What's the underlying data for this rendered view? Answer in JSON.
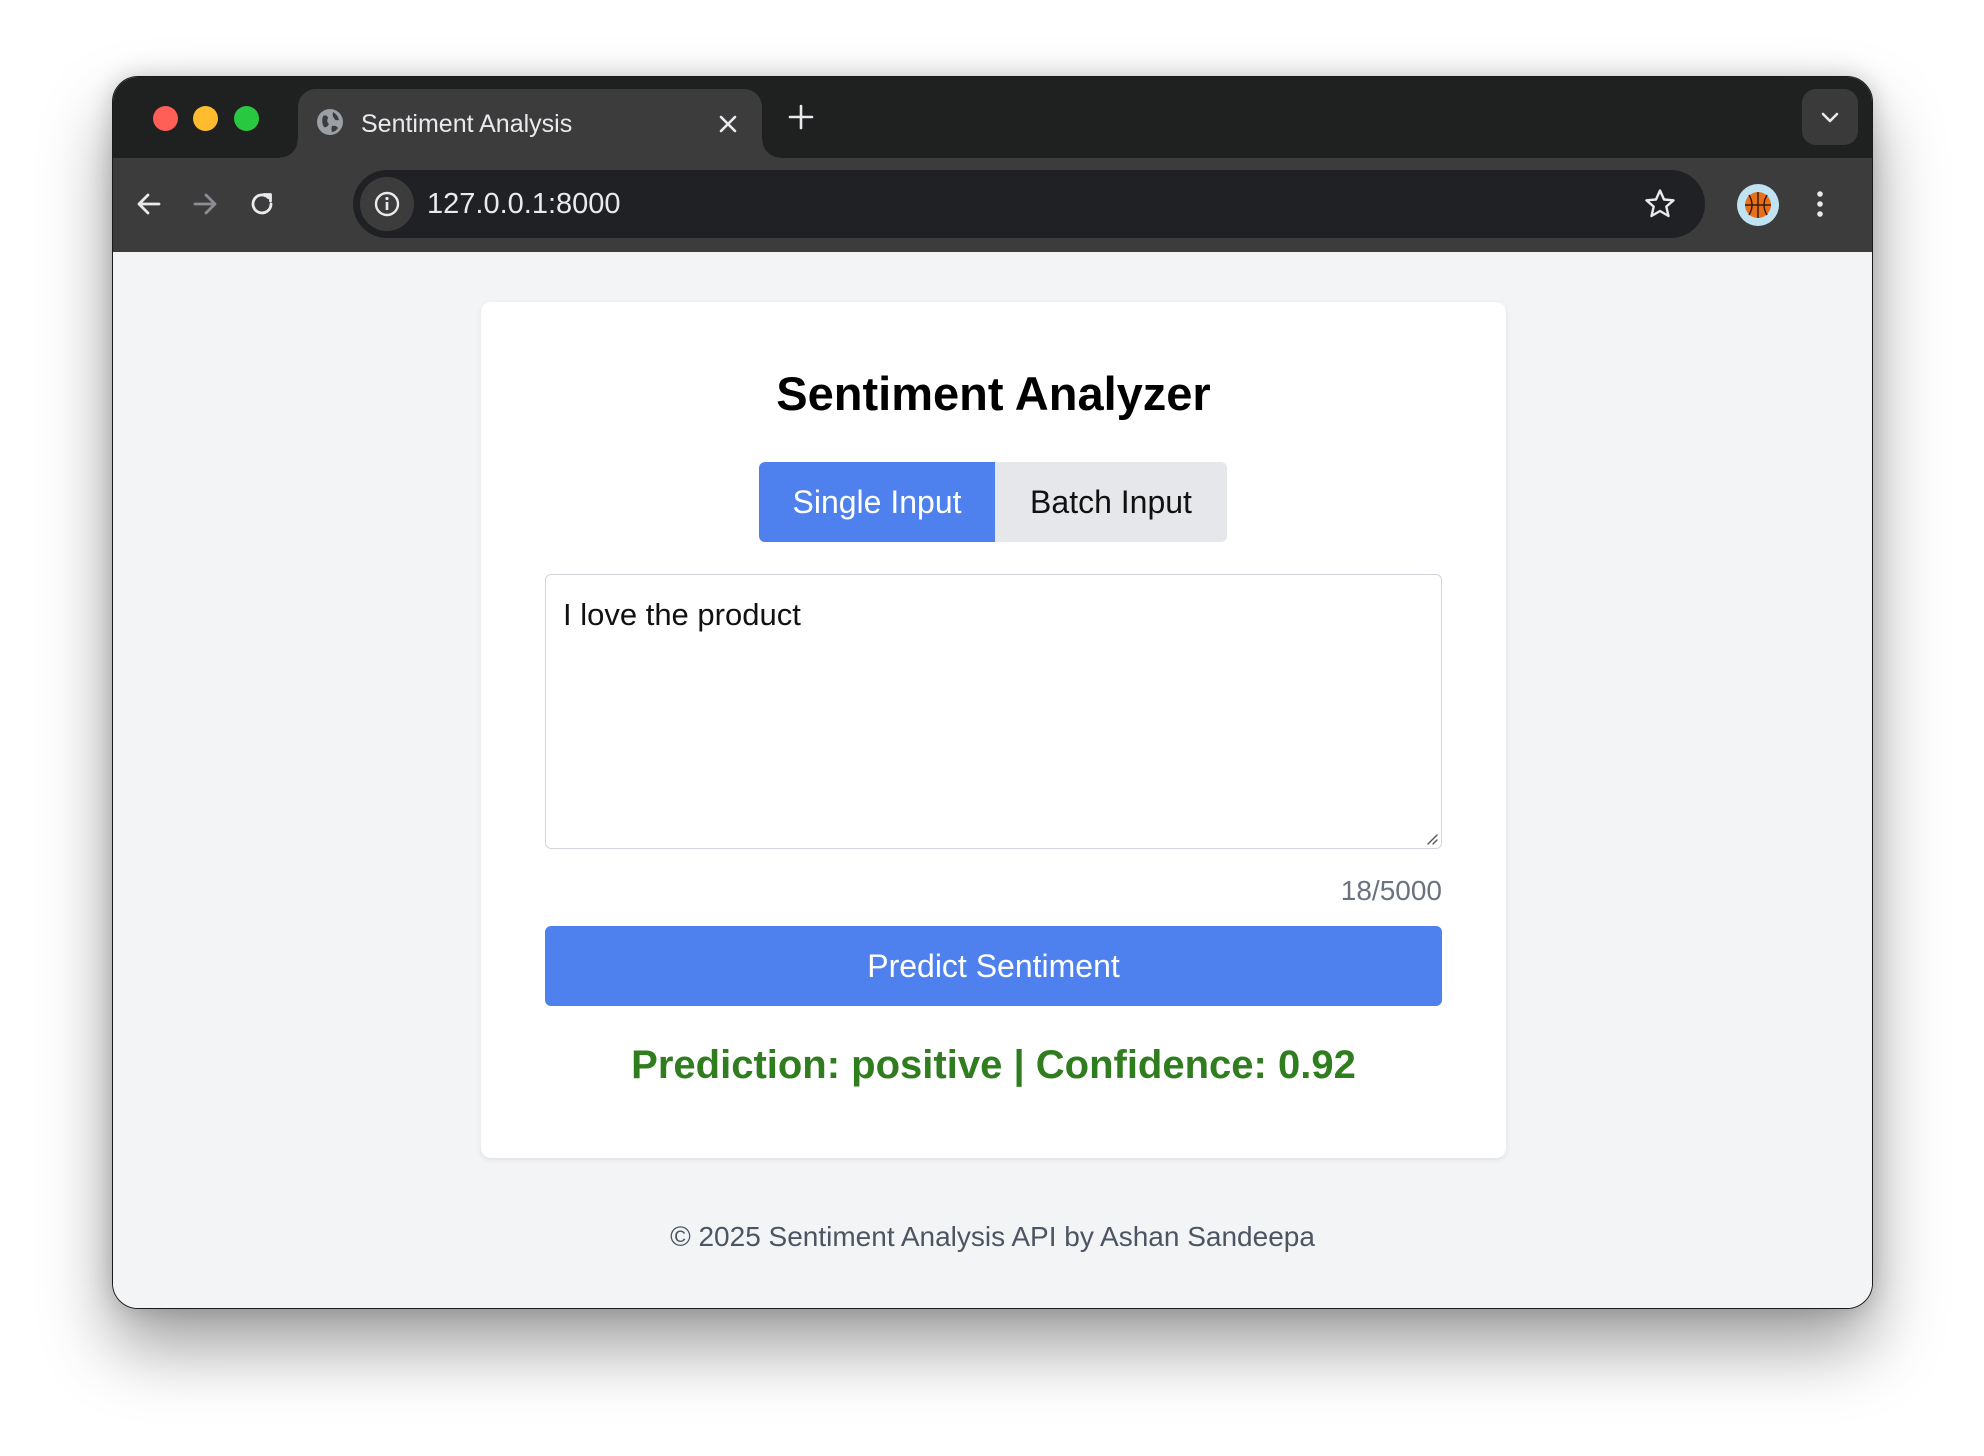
{
  "browser": {
    "tab_title": "Sentiment Analysis",
    "url": "127.0.0.1:8000",
    "icons": {
      "tab_favicon": "globe-icon",
      "close": "close-icon",
      "new_tab": "plus-icon",
      "tab_list": "chevron-down-icon",
      "back": "arrow-left-icon",
      "forward": "arrow-right-icon",
      "reload": "reload-icon",
      "site_info": "info-icon",
      "bookmark": "star-icon",
      "profile": "basketball-avatar-icon",
      "menu": "kebab-menu-icon"
    }
  },
  "page": {
    "title": "Sentiment Analyzer",
    "tabs": {
      "single_label": "Single Input",
      "batch_label": "Batch Input",
      "active": "Single Input"
    },
    "input": {
      "value": "I love the product"
    },
    "char_count": "18/5000",
    "predict_label": "Predict Sentiment",
    "result": "Prediction: positive | Confidence: 0.92",
    "footer": "© 2025 Sentiment Analysis API by Ashan Sandeepa"
  },
  "colors": {
    "accent": "#4f81ee",
    "positive": "#2f7d1e",
    "page_bg": "#f3f4f6",
    "inactive_tab": "#e5e7eb"
  }
}
